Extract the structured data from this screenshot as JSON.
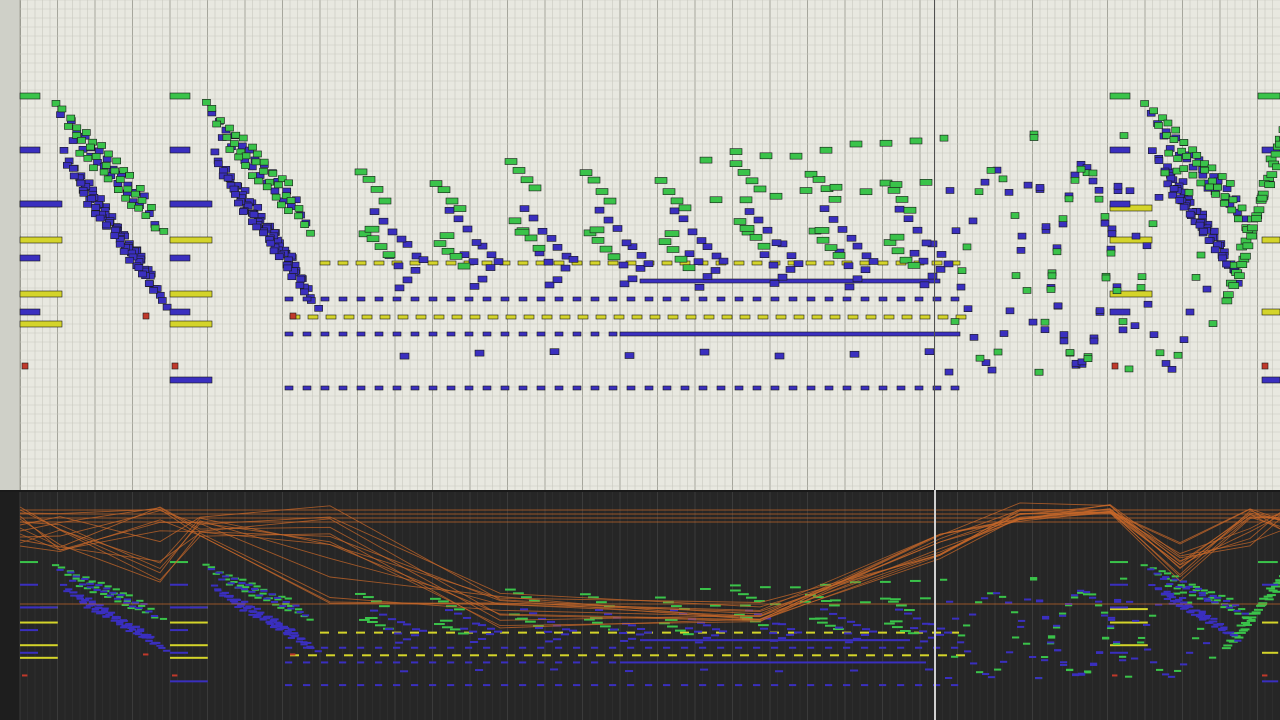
{
  "colors": {
    "roll_background": "#e8e8e0",
    "grid_line": "#c8c8be",
    "grid_bar_line": "#9a9a90",
    "track_green": "#3ac34a",
    "track_blue": "#3a2fbf",
    "track_yellow": "#d4d42a",
    "track_red": "#c0392b",
    "automation_orange": "#c8682a",
    "overview_background": "#262626"
  },
  "tracks": [
    {
      "id": "green",
      "color": "#3ac34a"
    },
    {
      "id": "blue",
      "color": "#3a2fbf"
    },
    {
      "id": "yellow",
      "color": "#d4d42a"
    },
    {
      "id": "red",
      "color": "#c0392b"
    }
  ],
  "playhead_visible": true,
  "view": {
    "upper_pane": "note-editor",
    "lower_pane": "velocity-automation-overview"
  }
}
